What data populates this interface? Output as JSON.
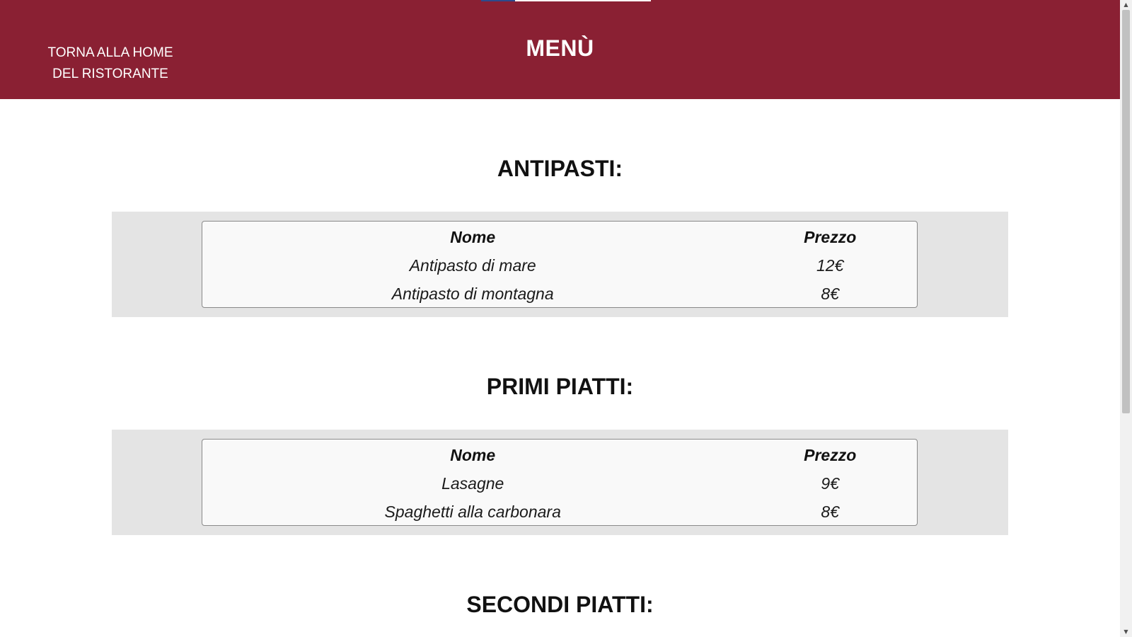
{
  "header": {
    "home_link": "TORNA ALLA HOME DEL RISTORANTE",
    "title": "MENÙ",
    "background_color": "#8a2033"
  },
  "sections": [
    {
      "title": "ANTIPASTI:",
      "columns": [
        "Nome",
        "Prezzo"
      ],
      "rows": [
        {
          "name": "Antipasto di mare",
          "price": "12€"
        },
        {
          "name": "Antipasto di montagna",
          "price": "8€"
        }
      ]
    },
    {
      "title": "PRIMI PIATTI:",
      "columns": [
        "Nome",
        "Prezzo"
      ],
      "rows": [
        {
          "name": "Lasagne",
          "price": "9€"
        },
        {
          "name": "Spaghetti alla carbonara",
          "price": "8€"
        }
      ]
    },
    {
      "title": "SECONDI PIATTI:"
    }
  ],
  "icons": {
    "scroll_up": "scroll-up-arrow-icon",
    "scroll_down": "scroll-down-arrow-icon"
  }
}
